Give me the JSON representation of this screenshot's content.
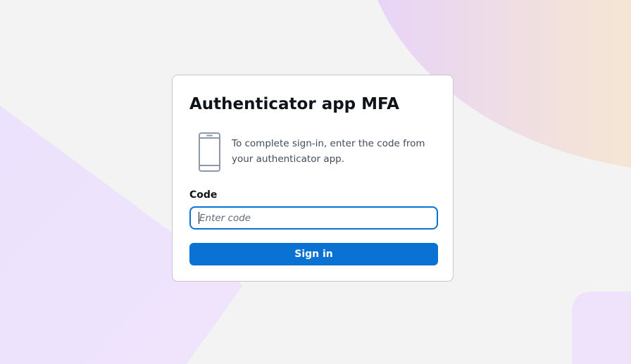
{
  "card": {
    "title": "Authenticator app MFA",
    "description": "To complete sign-in, enter the code from your authenticator app.",
    "code_label": "Code",
    "code_value": "",
    "code_placeholder": "Enter code",
    "signin_label": "Sign in",
    "icon": "phone-icon"
  },
  "colors": {
    "accent": "#0972d3",
    "background": "#f3f3f3",
    "card_background": "#ffffff",
    "card_border": "#c6c6cd",
    "text_primary": "#0f141a",
    "text_secondary": "#414d5c"
  }
}
